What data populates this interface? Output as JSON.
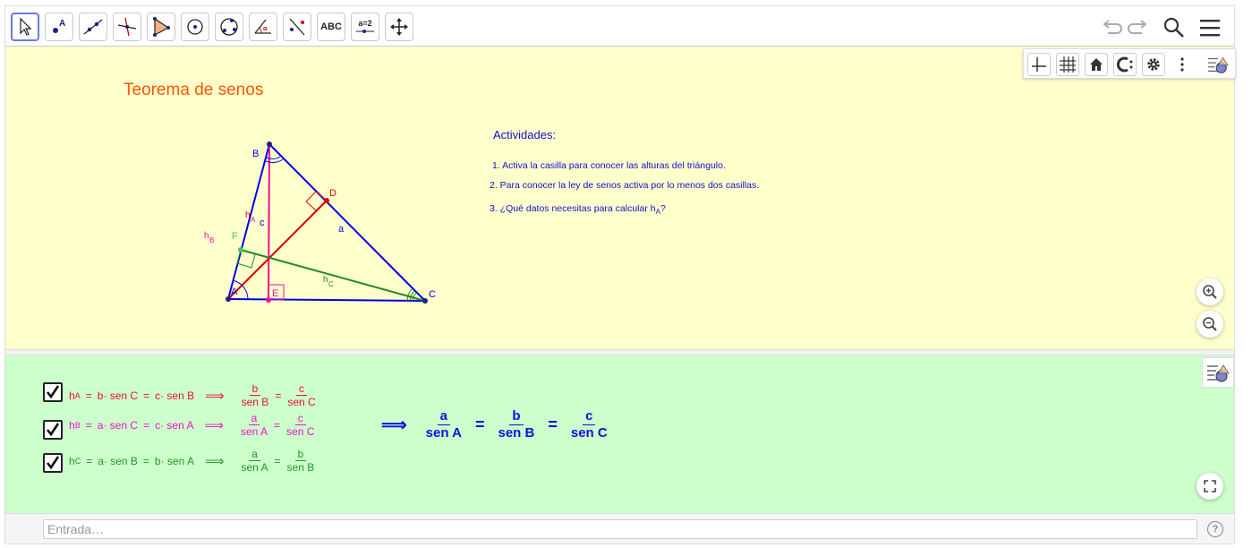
{
  "toolbar": {
    "tools": [
      {
        "name": "move-tool",
        "label": ""
      },
      {
        "name": "point-tool",
        "label": "A"
      },
      {
        "name": "line-tool",
        "label": ""
      },
      {
        "name": "perpendicular-tool",
        "label": ""
      },
      {
        "name": "polygon-tool",
        "label": ""
      },
      {
        "name": "circle-center-tool",
        "label": ""
      },
      {
        "name": "circle-three-points-tool",
        "label": ""
      },
      {
        "name": "angle-tool",
        "label": "α"
      },
      {
        "name": "reflect-tool",
        "label": ""
      },
      {
        "name": "text-tool",
        "label": "ABC"
      },
      {
        "name": "slider-tool",
        "label": "a=2"
      },
      {
        "name": "move-view-tool",
        "label": ""
      }
    ]
  },
  "graphics": {
    "title": "Teorema de senos",
    "title_color": "#ff5500",
    "activities": {
      "heading": "Actividades:",
      "item1": "1. Activa la casilla para conocer las alturas del triángulo.",
      "item2": "2. Para conocer la ley de senos activa por lo menos dos casillas.",
      "item3_prefix": "3. ¿Qué datos necesitas para calcular h",
      "item3_sub": "A",
      "item3_suffix": "?"
    },
    "labels": {
      "A": "A",
      "B": "B",
      "C": "C",
      "D": "D",
      "E": "E",
      "F": "F",
      "a": "a",
      "c": "c",
      "hA": "h",
      "hA_sub": "A",
      "hB": "h",
      "hB_sub": "B",
      "hC": "h",
      "hC_sub": "C"
    },
    "colors": {
      "triangle": "#0000ee",
      "hA": "#ee1199",
      "hB": "#dd0000",
      "hC": "#228822",
      "F": "#44cc44"
    }
  },
  "formulas": {
    "row1": {
      "checked": true,
      "h": "h",
      "sub": "A",
      "eq1": "=",
      "t1": "b· sen C",
      "eq2": "=",
      "t2": "c· sen B",
      "arrow": "⟹",
      "f1n": "b",
      "f1d": "sen B",
      "eq3": "=",
      "f2n": "c",
      "f2d": "sen C",
      "color": "#ee1133"
    },
    "row2": {
      "checked": true,
      "h": "h",
      "sub": "B",
      "eq1": "=",
      "t1": "a· sen C",
      "eq2": "=",
      "t2": "c· sen A",
      "arrow": "⟹",
      "f1n": "a",
      "f1d": "sen A",
      "eq3": "=",
      "f2n": "c",
      "f2d": "sen C",
      "color": "#ee11cc"
    },
    "row3": {
      "checked": true,
      "h": "h",
      "sub": "C",
      "eq1": "=",
      "t1": "a· sen B",
      "eq2": "=",
      "t2": "b· sen A",
      "arrow": "⟹",
      "f1n": "a",
      "f1d": "sen A",
      "eq3": "=",
      "f2n": "b",
      "f2d": "sen B",
      "color": "#229922"
    },
    "law": {
      "arrow": "⟹",
      "n1": "a",
      "d1": "sen A",
      "eq1": "=",
      "n2": "b",
      "d2": "sen B",
      "eq2": "=",
      "n3": "c",
      "d3": "sen C",
      "color": "#1010dd"
    }
  },
  "input": {
    "placeholder": "Entrada…"
  }
}
